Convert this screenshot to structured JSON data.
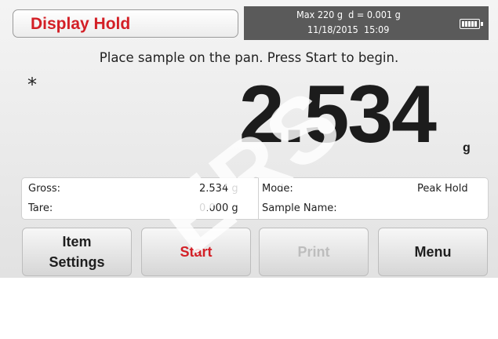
{
  "header": {
    "mode_title": "Display Hold",
    "capacity_info": "Max 220 g  d = 0.001 g",
    "datetime": "11/18/2015  15:09",
    "battery_icon": "battery-icon"
  },
  "instruction": "Place sample on the pan. Press Start to begin.",
  "stable_indicator": "*",
  "reading": {
    "value": "2.534",
    "unit": "g"
  },
  "info": {
    "gross_label": "Gross:",
    "gross_value": "2.534 g",
    "tare_label": "Tare:",
    "tare_value": "0.000 g",
    "mode_label": "Mode:",
    "mode_value": "Peak Hold",
    "sample_label": "Sample Name:",
    "sample_value": ""
  },
  "buttons": {
    "item_settings_line1": "Item",
    "item_settings_line2": "Settings",
    "start": "Start",
    "print": "Print",
    "menu": "Menu"
  },
  "watermark": "ERS",
  "colors": {
    "accent_red": "#d31f26",
    "status_bar": "#5a5a5a",
    "disabled_text": "#bdbdbd"
  }
}
